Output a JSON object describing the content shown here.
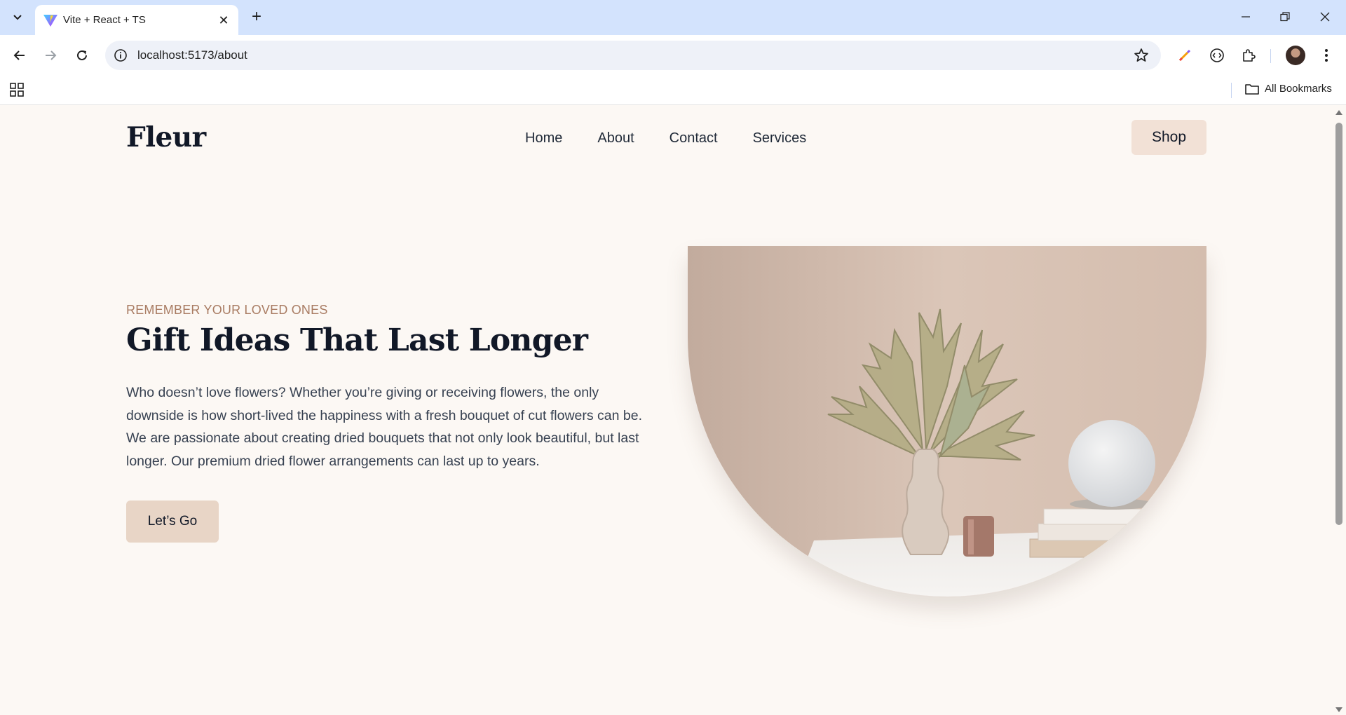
{
  "browser": {
    "tab_title": "Vite + React + TS",
    "url": "localhost:5173/about",
    "bookmarks_label": "All Bookmarks"
  },
  "site": {
    "logo": "Fleur",
    "nav": [
      "Home",
      "About",
      "Contact",
      "Services"
    ],
    "shop_label": "Shop"
  },
  "hero": {
    "eyebrow": "REMEMBER YOUR LOVED ONES",
    "title": "Gift Ideas That Last Longer",
    "body": "Who doesn’t love flowers? Whether you’re giving or receiving flowers, the only downside is how short-lived the happiness with a fresh bouquet of cut flowers can be. We are passionate about creating dried bouquets that not only look beautiful, but last longer. Our premium dried flower arrangements can last up to years.",
    "cta_label": "Let’s Go"
  },
  "colors": {
    "page_bg": "#fcf8f4",
    "accent_text": "#a97c63",
    "shop_button": "#f2e1d6",
    "cta_button": "#e8d5c6",
    "browser_tabbar": "#d3e3fd"
  }
}
